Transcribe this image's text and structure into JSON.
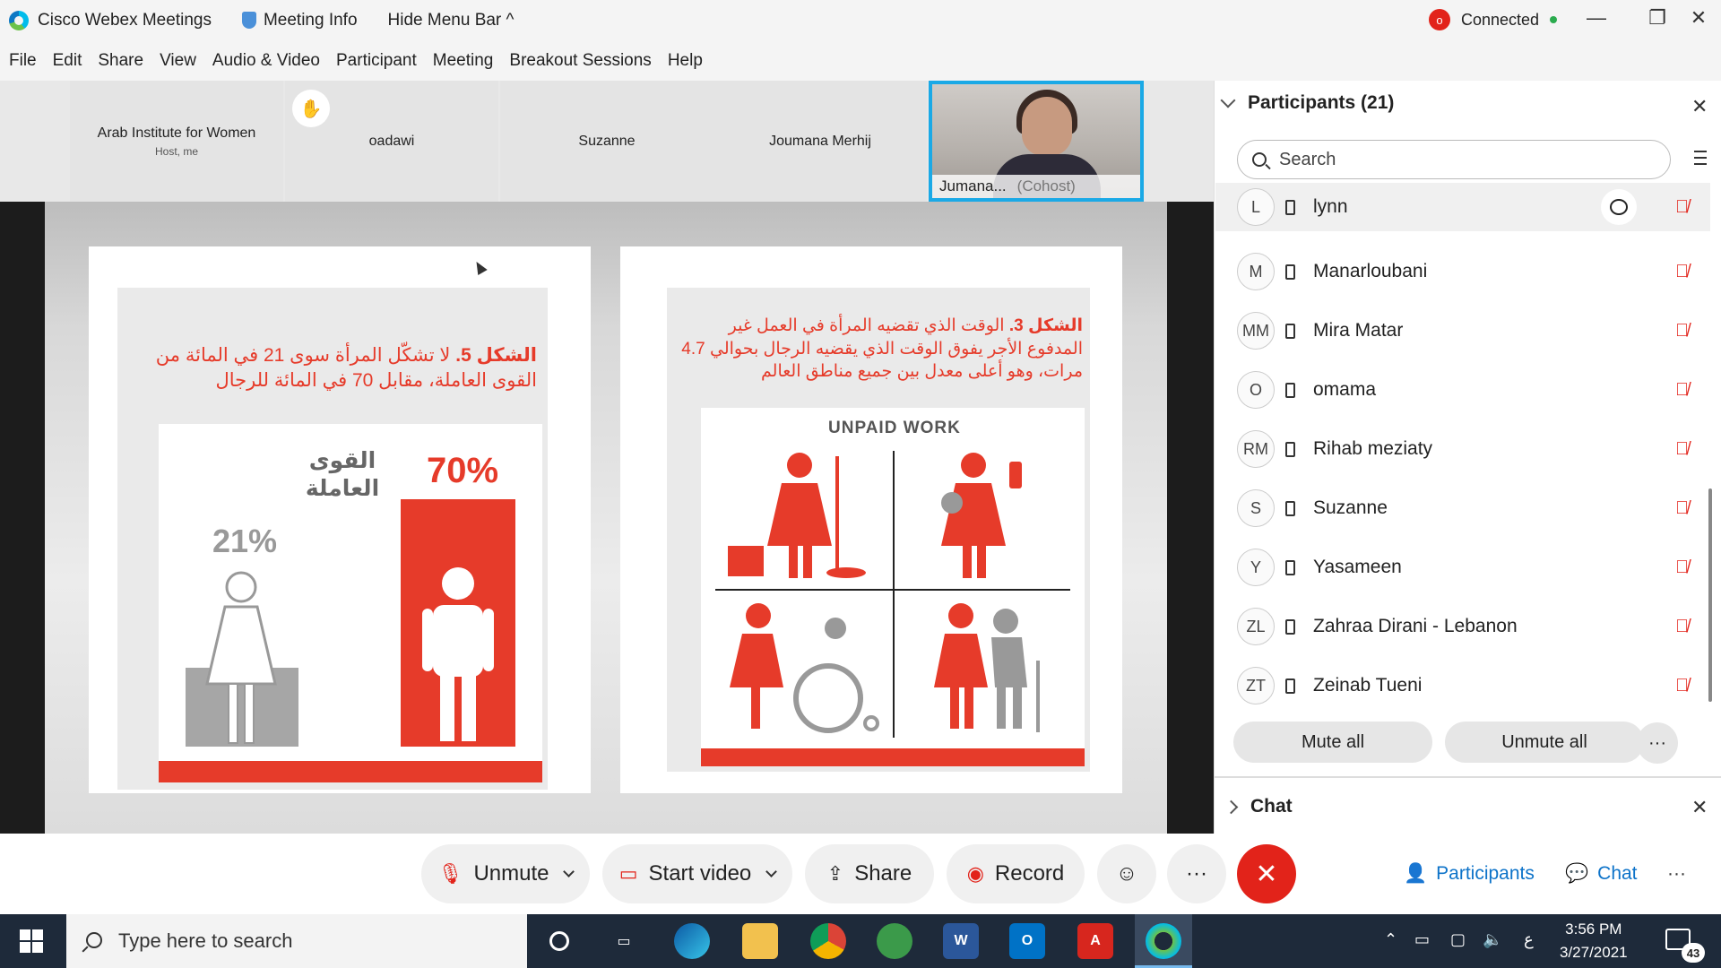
{
  "titlebar": {
    "app_name": "Cisco Webex Meetings",
    "meeting_info": "Meeting Info",
    "hide_menu": "Hide Menu Bar ^",
    "rec_letter": "o",
    "status": "Connected"
  },
  "menu": [
    "File",
    "Edit",
    "Share",
    "View",
    "Audio & Video",
    "Participant",
    "Meeting",
    "Breakout Sessions",
    "Help"
  ],
  "thumbnails": [
    {
      "name": "Arab Institute for Women",
      "sub": "Host, me"
    },
    {
      "name": "oadawi"
    },
    {
      "name": "Suzanne"
    },
    {
      "name": "Joumana Merhij"
    }
  ],
  "active_video": {
    "name": "Jumana...",
    "role": "(Cohost)"
  },
  "slide": {
    "left_caption_bold": "الشكل 5.",
    "left_caption_rest": "لا تشكّل المرأة سوى 21 في المائة من القوى العاملة، مقابل 70 في المائة للرجال",
    "workforce_label": "القوى العاملة",
    "women_pct": "21%",
    "men_pct": "70%",
    "right_caption_bold": "الشكل 3.",
    "right_caption_rest": "الوقت الذي تقضيه المرأة في العمل غير المدفوع الأجر يفوق الوقت الذي يقضيه الرجال بحوالي 4.7 مرات، وهو أعلى معدل بين جميع مناطق العالم",
    "unpaid_title": "UNPAID WORK"
  },
  "participants_panel": {
    "title": "Participants (21)",
    "search_placeholder": "Search",
    "participants": [
      {
        "initials": "L",
        "name": "lynn"
      },
      {
        "initials": "M",
        "name": "Manarloubani"
      },
      {
        "initials": "MM",
        "name": "Mira Matar"
      },
      {
        "initials": "O",
        "name": "omama"
      },
      {
        "initials": "RM",
        "name": "Rihab meziaty"
      },
      {
        "initials": "S",
        "name": "Suzanne"
      },
      {
        "initials": "Y",
        "name": "Yasameen"
      },
      {
        "initials": "ZL",
        "name": "Zahraa Dirani - Lebanon"
      },
      {
        "initials": "ZT",
        "name": "Zeinab Tueni"
      }
    ],
    "mute_all": "Mute all",
    "unmute_all": "Unmute all",
    "more": "···"
  },
  "chat_panel": {
    "title": "Chat"
  },
  "controls": {
    "unmute": "Unmute",
    "start_video": "Start video",
    "share": "Share",
    "record": "Record",
    "more": "···",
    "participants": "Participants",
    "chat": "Chat",
    "right_more": "···"
  },
  "taskbar": {
    "search_placeholder": "Type here to search",
    "lang": "ع",
    "time": "3:56 PM",
    "date": "3/27/2021",
    "notifications": "43"
  },
  "colors": {
    "accent_red": "#e63b2a",
    "webex_blue": "#0d73c9",
    "video_border": "#1aa9e6",
    "end_red": "#e2231a"
  }
}
